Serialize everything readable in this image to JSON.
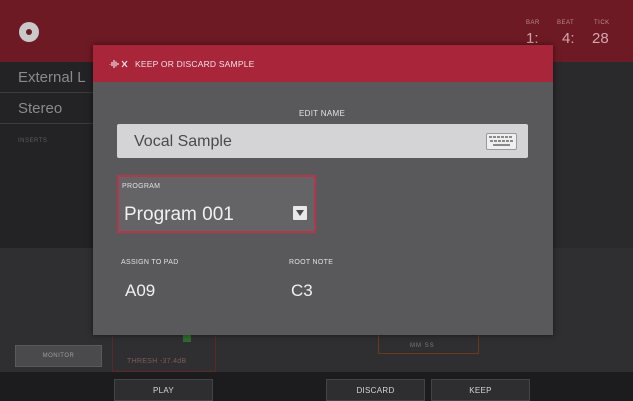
{
  "top_bar": {
    "bar_label": "BAR",
    "bar_value": "1:",
    "beat_label": "BEAT",
    "beat_value": "4:",
    "tick_label": "TICK",
    "tick_value": "28"
  },
  "background": {
    "track_name": "External L",
    "channel_mode": "Stereo",
    "inserts_label": "INSERTS",
    "monitor_label": "MONITOR",
    "thresh_label": "THRESH",
    "thresh_value": "-37.4dB",
    "time_units": "MM    SS"
  },
  "dialog": {
    "title": "KEEP OR DISCARD SAMPLE",
    "edit_name_label": "EDIT NAME",
    "name_value": "Vocal Sample",
    "program_label": "PROGRAM",
    "program_value": "Program 001",
    "assign_pad_label": "ASSIGN TO PAD",
    "assign_pad_value": "A09",
    "root_note_label": "ROOT NOTE",
    "root_note_value": "C3"
  },
  "bottom_bar": {
    "play_label": "PLAY",
    "discard_label": "DISCARD",
    "keep_label": "KEEP"
  },
  "colors": {
    "accent": "#a8253a",
    "top_bar": "#6e1a24",
    "dialog_bg": "#59595c"
  }
}
